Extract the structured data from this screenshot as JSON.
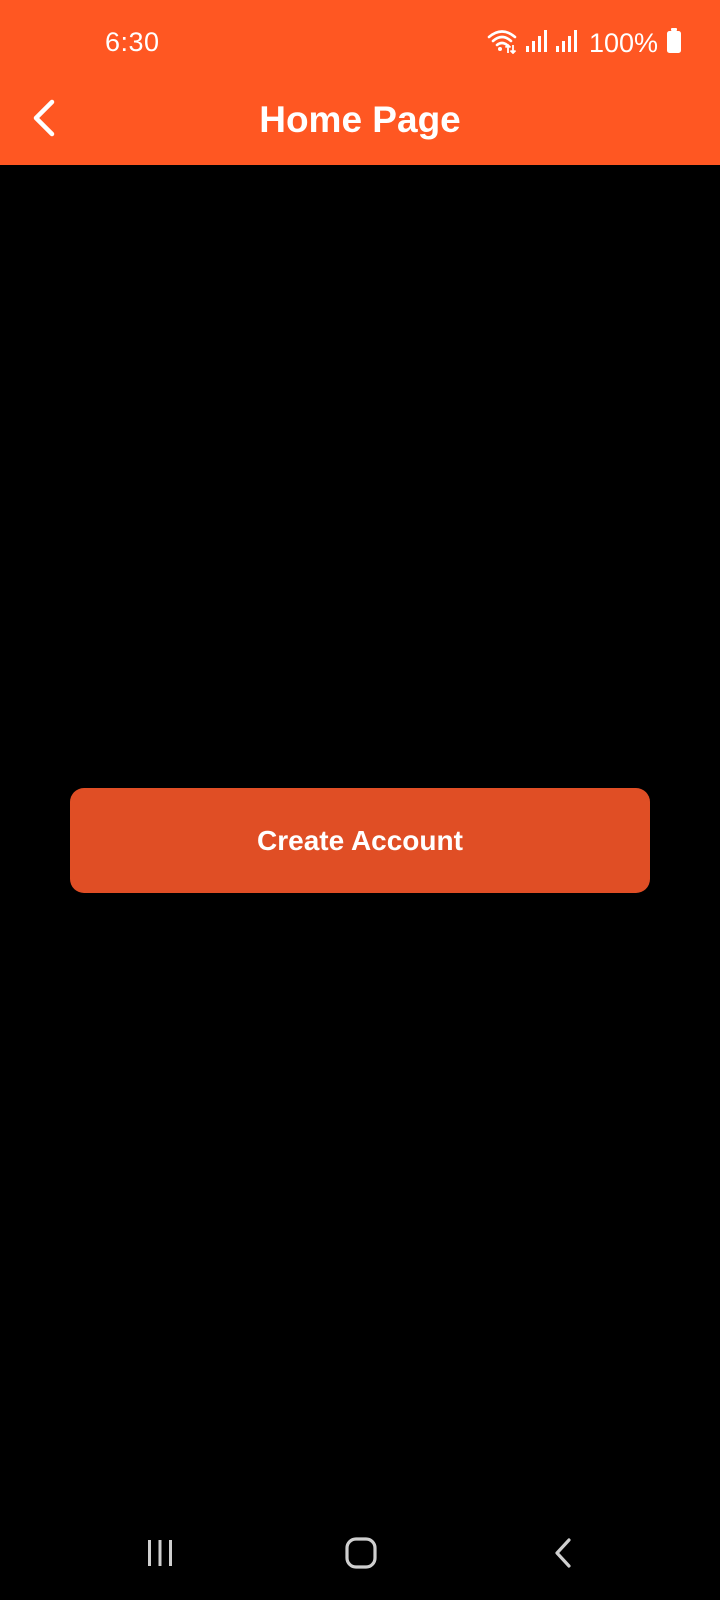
{
  "status_bar": {
    "time": "6:30",
    "battery_percent": "100%",
    "icons": [
      "wifi-icon",
      "signal-icon",
      "signal-icon",
      "battery-icon"
    ]
  },
  "app_bar": {
    "title": "Home Page",
    "back_icon": "chevron-left-icon",
    "color": "#FF5722"
  },
  "main": {
    "create_account_label": "Create Account",
    "button_color": "#E04E25"
  },
  "nav_bar": {
    "buttons": [
      "recent-apps-icon",
      "home-icon",
      "back-icon"
    ]
  }
}
